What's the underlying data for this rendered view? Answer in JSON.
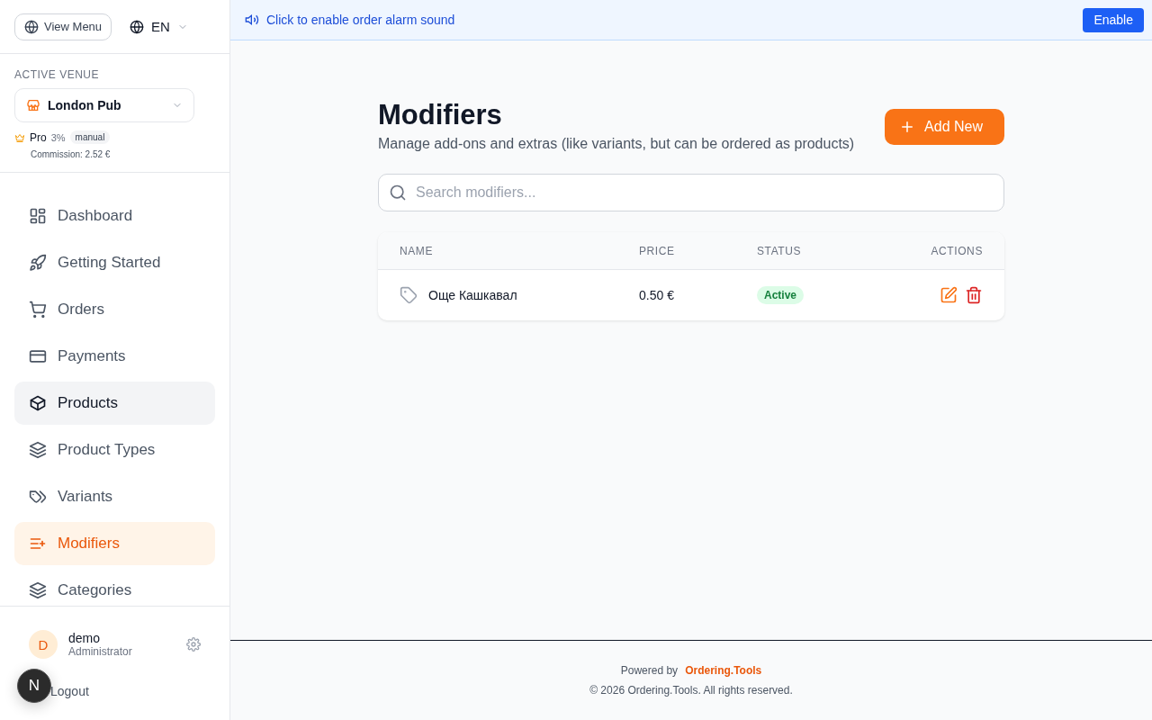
{
  "sidebar": {
    "view_menu": "View Menu",
    "language": "EN",
    "venue_label": "ACTIVE VENUE",
    "venue": "London Pub",
    "plan": "Pro",
    "plan_rate": "3%",
    "plan_mode": "manual",
    "commission": "Commission: 2.52 €",
    "items": [
      {
        "label": "Dashboard",
        "selected": false,
        "hovered": false
      },
      {
        "label": "Getting Started",
        "selected": false,
        "hovered": false
      },
      {
        "label": "Orders",
        "selected": false,
        "hovered": false
      },
      {
        "label": "Payments",
        "selected": false,
        "hovered": false
      },
      {
        "label": "Products",
        "selected": false,
        "hovered": true
      },
      {
        "label": "Product Types",
        "selected": false,
        "hovered": false
      },
      {
        "label": "Variants",
        "selected": false,
        "hovered": false
      },
      {
        "label": "Modifiers",
        "selected": true,
        "hovered": false
      },
      {
        "label": "Categories",
        "selected": false,
        "hovered": false
      }
    ],
    "user": {
      "initial": "D",
      "name": "demo",
      "role": "Administrator"
    },
    "logout": "Logout",
    "dev_badge": "N"
  },
  "banner": {
    "text": "Click to enable order alarm sound",
    "button": "Enable"
  },
  "page": {
    "title": "Modifiers",
    "subtitle": "Manage add-ons and extras (like variants, but can be ordered as products)",
    "add_button": "Add New",
    "search": {
      "placeholder": "Search modifiers..."
    }
  },
  "table": {
    "columns": [
      "NAME",
      "PRICE",
      "STATUS",
      "ACTIONS"
    ],
    "rows": [
      {
        "name": "Още Кашкавал",
        "price": "0.50 €",
        "status": "Active",
        "active": true
      }
    ]
  },
  "footer": {
    "powered_by": "Powered by",
    "brand": "Ordering.Tools",
    "copyright": "© 2026 Ordering.Tools. All rights reserved."
  }
}
